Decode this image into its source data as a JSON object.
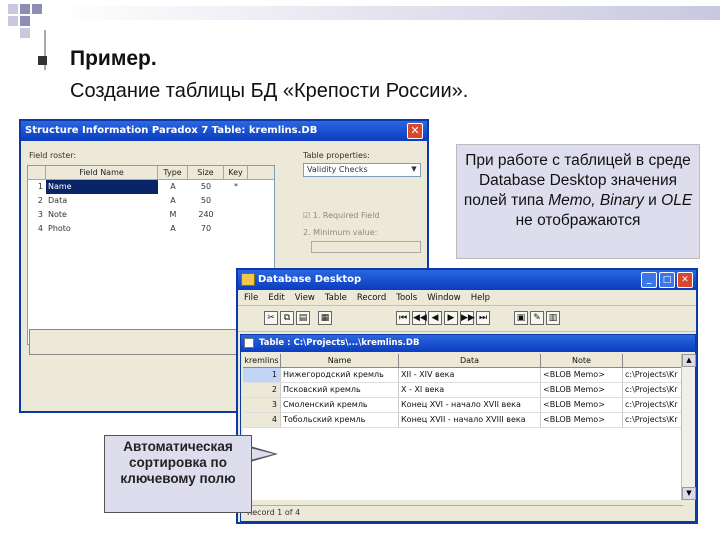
{
  "slide": {
    "heading": "Пример.",
    "subheading": "Создание таблицы БД «Крепости России»."
  },
  "structure_window": {
    "title": "Structure Information Paradox 7 Table: kremlins.DB",
    "field_roster_label": "Field roster:",
    "columns": [
      "Field Name",
      "Type",
      "Size",
      "Key"
    ],
    "rows": [
      {
        "n": "1",
        "name": "Name",
        "type": "A",
        "size": "50",
        "key": "*"
      },
      {
        "n": "2",
        "name": "Data",
        "type": "A",
        "size": "50",
        "key": ""
      },
      {
        "n": "3",
        "name": "Note",
        "type": "M",
        "size": "240",
        "key": ""
      },
      {
        "n": "4",
        "name": "Photo",
        "type": "A",
        "size": "70",
        "key": ""
      }
    ],
    "table_properties_label": "Table properties:",
    "table_properties_value": "Validity Checks",
    "required_field_label": "1. Required Field",
    "minimum_value_label": "2. Minimum value:"
  },
  "note_text": {
    "line1": "При работе с таблицей в среде Database Desktop значения полей типа",
    "em": "Memo, Binary",
    "and": " и ",
    "em2": "OLE",
    "line2": " не отображаются"
  },
  "desktop_window": {
    "title": "Database Desktop",
    "menu": [
      "File",
      "Edit",
      "View",
      "Table",
      "Record",
      "Tools",
      "Window",
      "Help"
    ],
    "table_title": "Table : C:\\Projects\\...\\kremlins.DB",
    "columns": [
      "kremlins",
      "Name",
      "Data",
      "Note",
      ""
    ],
    "rows": [
      {
        "k": "1",
        "name": "Нижегородский кремль",
        "data": "XII - XIV века",
        "note": "<BLOB Memo>",
        "path": "c:\\Projects\\Kr"
      },
      {
        "k": "2",
        "name": "Псковский кремль",
        "data": "X - XI века",
        "note": "<BLOB Memo>",
        "path": "c:\\Projects\\Kr"
      },
      {
        "k": "3",
        "name": "Смоленский кремль",
        "data": "Конец XVI - начало XVII века",
        "note": "<BLOB Memo>",
        "path": "c:\\Projects\\Kr"
      },
      {
        "k": "4",
        "name": "Тобольский кремль",
        "data": "Конец XVII - начало XVIII века",
        "note": "<BLOB Memo>",
        "path": "c:\\Projects\\Kr"
      }
    ],
    "status": "Record 1 of 4"
  },
  "callout": {
    "text": "Автоматическая сортировка по ключевому полю"
  }
}
